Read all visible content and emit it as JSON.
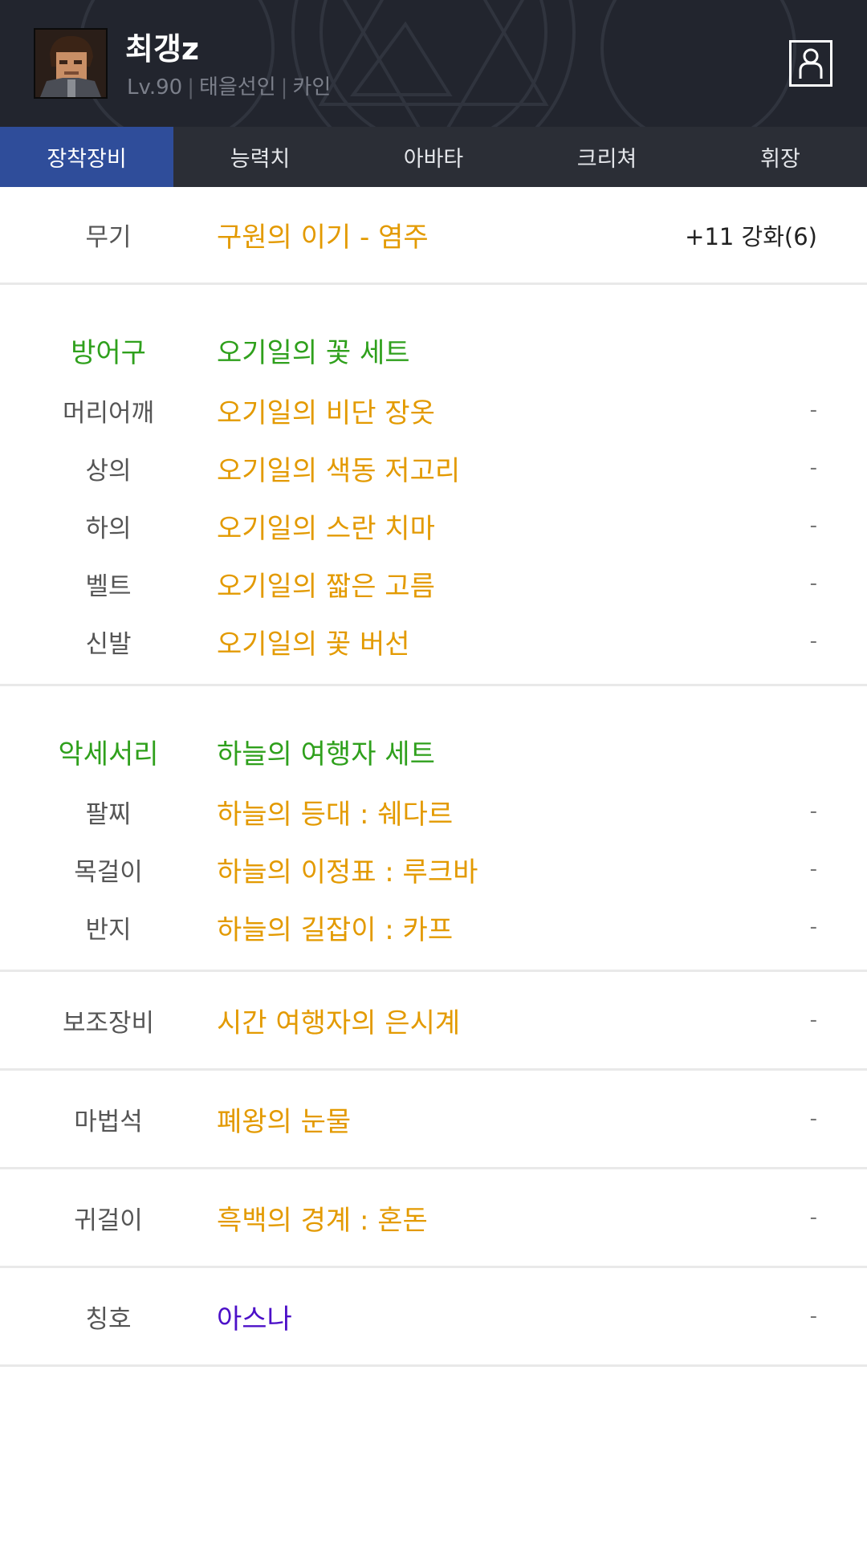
{
  "header": {
    "name": "최갱z",
    "level": "Lv.90",
    "job": "태을선인",
    "server": "카인"
  },
  "tabs": [
    {
      "label": "장착장비",
      "active": true
    },
    {
      "label": "능력치",
      "active": false
    },
    {
      "label": "아바타",
      "active": false
    },
    {
      "label": "크리쳐",
      "active": false
    },
    {
      "label": "휘장",
      "active": false
    }
  ],
  "weapon": {
    "slot": "무기",
    "name": "구원의 이기 - 염주",
    "value": "+11 강화(6)"
  },
  "armor": {
    "label": "방어구",
    "set_name": "오기일의 꽃 세트",
    "items": [
      {
        "slot": "머리어깨",
        "name": "오기일의 비단 장옷",
        "value": "-"
      },
      {
        "slot": "상의",
        "name": "오기일의 색동 저고리",
        "value": "-"
      },
      {
        "slot": "하의",
        "name": "오기일의 스란 치마",
        "value": "-"
      },
      {
        "slot": "벨트",
        "name": "오기일의 짧은 고름",
        "value": "-"
      },
      {
        "slot": "신발",
        "name": "오기일의 꽃 버선",
        "value": "-"
      }
    ]
  },
  "accessory": {
    "label": "악세서리",
    "set_name": "하늘의 여행자 세트",
    "items": [
      {
        "slot": "팔찌",
        "name": "하늘의 등대 : 쉐다르",
        "value": "-"
      },
      {
        "slot": "목걸이",
        "name": "하늘의 이정표 : 루크바",
        "value": "-"
      },
      {
        "slot": "반지",
        "name": "하늘의 길잡이 : 카프",
        "value": "-"
      }
    ]
  },
  "sub_weapon": {
    "slot": "보조장비",
    "name": "시간 여행자의 은시계",
    "value": "-"
  },
  "magic_stone": {
    "slot": "마법석",
    "name": "폐왕의 눈물",
    "value": "-"
  },
  "earring": {
    "slot": "귀걸이",
    "name": "흑백의 경계 : 혼돈",
    "value": "-"
  },
  "title_item": {
    "slot": "칭호",
    "name": "아스나",
    "value": "-"
  },
  "colors": {
    "header_bg": "#22252e",
    "tab_active": "#2f4d9a",
    "item_orange": "#e39a00",
    "set_green": "#2fa01c",
    "title_purple": "#4c10c8"
  }
}
